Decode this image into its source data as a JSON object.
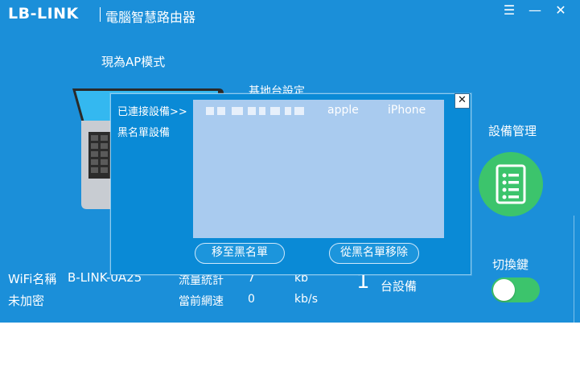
{
  "window": {
    "logo": "LB-LINK",
    "title": "電腦智慧路由器",
    "menu_icon": "☰",
    "min_icon": "—",
    "close_icon": "✕"
  },
  "main": {
    "mode": "現為AP模式",
    "station_label": "基地台設定",
    "device_management": "設備管理",
    "switch_label": "切換鍵",
    "switch_on": true
  },
  "status": {
    "wifi_name_label": "WiFi名稱",
    "wifi_name": "B-LINK-0A25",
    "encryption": "未加密",
    "traffic_label": "流量統計",
    "traffic_value": "7",
    "traffic_unit": "kb",
    "speed_label": "當前網速",
    "speed_value": "0",
    "speed_unit": "kb/s",
    "device_count": "1",
    "device_count_label": "台設備"
  },
  "dialog": {
    "connected_label": "已連接設備>>",
    "blacklist_label": "黑名單設備",
    "close_icon": "✕",
    "devices": [
      {
        "name": "apple",
        "type": "iPhone"
      }
    ],
    "move_to_blacklist": "移至黑名單",
    "remove_from_blacklist": "從黑名單移除"
  },
  "colors": {
    "background": "#1b8fd9",
    "dialog": "#0a8ad6",
    "list": "#a9cbef",
    "accent_green": "#3cc46c"
  }
}
